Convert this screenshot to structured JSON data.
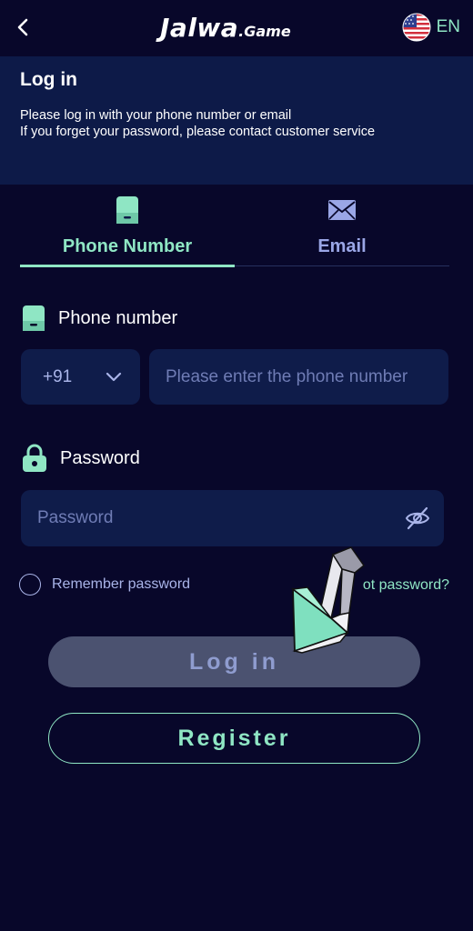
{
  "header": {
    "brand_main": "Jalwa",
    "brand_sub": ".Game",
    "language_code": "EN",
    "back_icon": "chevron-left-icon",
    "flag_icon": "us-flag-icon"
  },
  "hero": {
    "title": "Log in",
    "line1": "Please log in with your phone number or email",
    "line2": "If you forget your password, please contact customer service"
  },
  "tabs": [
    {
      "label": "Phone Number",
      "icon": "phone-icon",
      "active": true
    },
    {
      "label": "Email",
      "icon": "mail-icon",
      "active": false
    }
  ],
  "phone": {
    "label": "Phone number",
    "country_code": "+91",
    "placeholder": "Please enter the phone number",
    "value": ""
  },
  "password": {
    "label": "Password",
    "placeholder": "Password",
    "value": ""
  },
  "remember_label": "Remember password",
  "forgot_label": "ot password?",
  "buttons": {
    "login": "Log in",
    "register": "Register"
  },
  "colors": {
    "background": "#08072a",
    "hero": "#0d1a48",
    "accent": "#8fe6c4",
    "muted": "#9aa6e6",
    "input_bg": "#0f1c4a",
    "login_button": "#4b5270"
  }
}
